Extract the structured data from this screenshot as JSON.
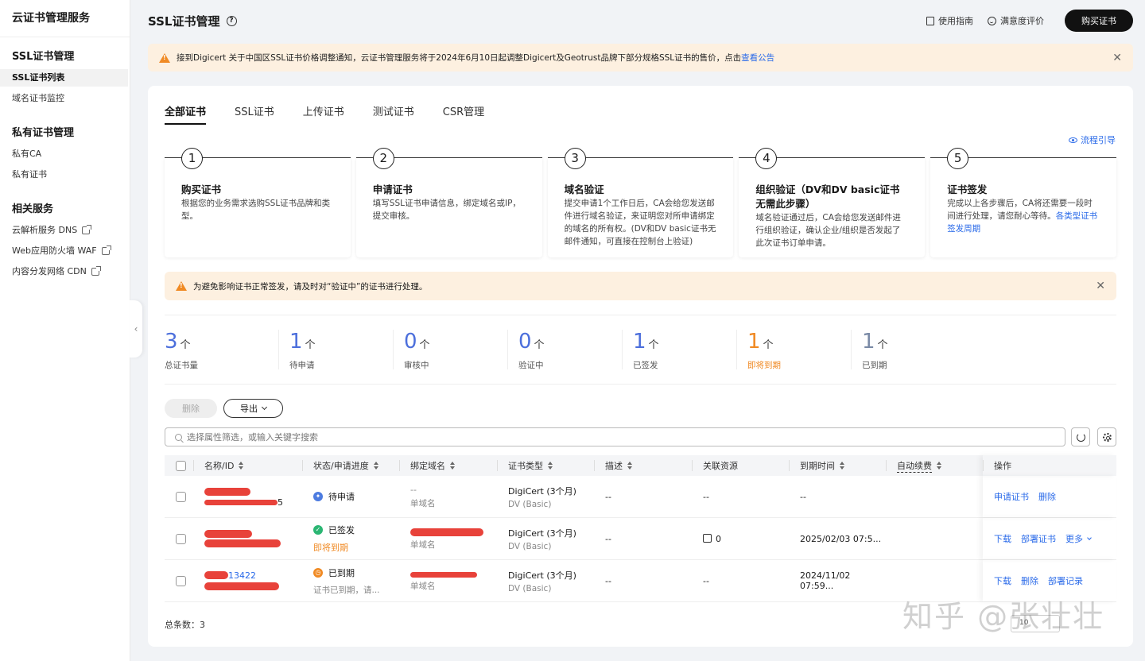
{
  "sidebar": {
    "title": "云证书管理服务",
    "groups": [
      {
        "label": "SSL证书管理",
        "items": [
          {
            "label": "SSL证书列表"
          },
          {
            "label": "域名证书监控"
          }
        ]
      },
      {
        "label": "私有证书管理",
        "items": [
          {
            "label": "私有CA"
          },
          {
            "label": "私有证书"
          }
        ]
      },
      {
        "label": "相关服务",
        "items": [
          {
            "label": "云解析服务 DNS"
          },
          {
            "label": "Web应用防火墙 WAF"
          },
          {
            "label": "内容分发网络 CDN"
          }
        ]
      }
    ]
  },
  "header": {
    "title": "SSL证书管理",
    "guide": "使用指南",
    "rating": "满意度评价",
    "buy": "购买证书"
  },
  "banner": {
    "text": "接到Digicert 关于中国区SSL证书价格调整通知，云证书管理服务将于2024年6月10日起调整Digicert及Geotrust品牌下部分规格SSL证书的售价，点击",
    "link": "查看公告"
  },
  "tabs": [
    "全部证书",
    "SSL证书",
    "上传证书",
    "测试证书",
    "CSR管理"
  ],
  "flow_guide": "流程引导",
  "steps": [
    {
      "num": "1",
      "title": "购买证书",
      "desc": "根据您的业务需求选购SSL证书品牌和类型。"
    },
    {
      "num": "2",
      "title": "申请证书",
      "desc": "填写SSL证书申请信息，绑定域名或IP，提交审核。"
    },
    {
      "num": "3",
      "title": "域名验证",
      "desc": "提交申请1个工作日后，CA会给您发送邮件进行域名验证，来证明您对所申请绑定的域名的所有权。(DV和DV basic证书无邮件通知，可直接在控制台上验证)"
    },
    {
      "num": "4",
      "title": "组织验证（DV和DV basic证书无需此步骤）",
      "desc": "域名验证通过后，CA会给您发送邮件进行组织验证，确认企业/组织是否发起了此次证书订单申请。"
    },
    {
      "num": "5",
      "title": "证书签发",
      "desc": "完成以上各步骤后，CA将还需要一段时间进行处理，请您耐心等待。",
      "link": "各类型证书签发周期"
    }
  ],
  "alert": "为避免影响证书正常签发，请及时对“验证中”的证书进行处理。",
  "stats": [
    {
      "value": "3",
      "unit": "个",
      "label": "总证书量"
    },
    {
      "value": "1",
      "unit": "个",
      "label": "待申请"
    },
    {
      "value": "0",
      "unit": "个",
      "label": "审核中"
    },
    {
      "value": "0",
      "unit": "个",
      "label": "验证中"
    },
    {
      "value": "1",
      "unit": "个",
      "label": "已签发"
    },
    {
      "value": "1",
      "unit": "个",
      "label": "即将到期"
    },
    {
      "value": "1",
      "unit": "个",
      "label": "已到期"
    }
  ],
  "actions": {
    "delete": "删除",
    "export": "导出"
  },
  "search": {
    "placeholder": "选择属性筛选，或输入关键字搜索"
  },
  "table": {
    "columns": [
      "名称/ID",
      "状态/申请进度",
      "绑定域名",
      "证书类型",
      "描述",
      "关联资源",
      "到期时间",
      "自动续费",
      "操作"
    ],
    "rows": [
      {
        "id_suffix": "5",
        "status": "待申请",
        "status_sub": "",
        "domain": "--",
        "domain_type": "单域名",
        "type": "DigiCert (3个月)",
        "type_sub": "DV (Basic)",
        "desc": "--",
        "resource": "--",
        "expire": "--",
        "ops": [
          "申请证书",
          "删除"
        ]
      },
      {
        "id_suffix": "",
        "status": "已签发",
        "status_sub": "即将到期",
        "domain": "",
        "domain_type": "单域名",
        "type": "DigiCert (3个月)",
        "type_sub": "DV (Basic)",
        "desc": "--",
        "resource": "0",
        "expire": "2025/02/03 07:5...",
        "ops": [
          "下载",
          "部署证书",
          "更多"
        ]
      },
      {
        "id_suffix": "13422",
        "status": "已到期",
        "status_sub": "证书已到期，请...",
        "domain": "",
        "domain_type": "单域名",
        "type": "DigiCert (3个月)",
        "type_sub": "DV (Basic)",
        "desc": "--",
        "resource": "--",
        "expire": "2024/11/02 07:59...",
        "ops": [
          "下载",
          "删除",
          "部署记录"
        ]
      }
    ]
  },
  "total": "总条数：3",
  "watermark": "知乎 @张壮壮",
  "pager": "10"
}
